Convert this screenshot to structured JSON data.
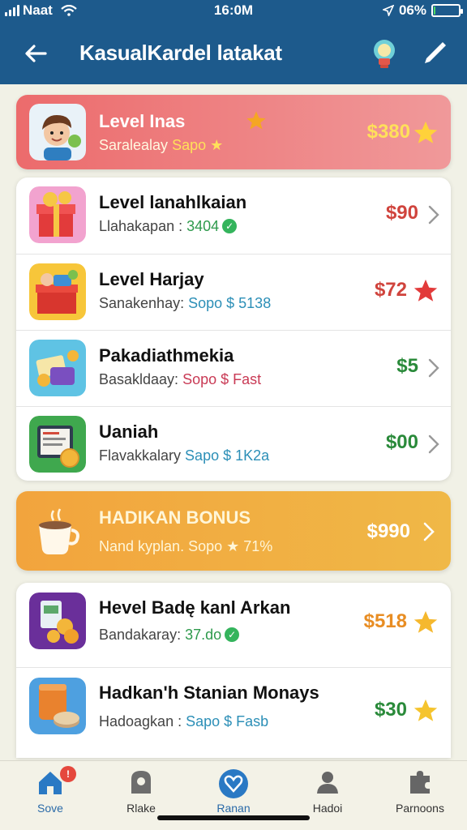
{
  "status_bar": {
    "carrier": "Naat",
    "time": "16:0M",
    "battery": "06%",
    "battery_level": 0.06
  },
  "header": {
    "title": "KasualKardel latakat",
    "back_icon": "arrow-left-icon",
    "bulb_icon": "lightbulb-icon",
    "edit_icon": "pencil-icon"
  },
  "featured": {
    "title": "Level Inas",
    "subtitle": "Saralealay",
    "subtitle_tag": "Sapo",
    "price": "$380",
    "accent": "#ec6b6c"
  },
  "list_top": [
    {
      "title": "Level lanahlkaian",
      "subtitle": "Llahakapan :",
      "detail": "3404",
      "detail_style": "sub-a",
      "price": "$90",
      "price_color": "red",
      "trail": "chevron",
      "thumb": "gift-box",
      "check": true
    },
    {
      "title": "Level Harjay",
      "subtitle": "Sanakenhay:",
      "detail": "Sopo $ 5138",
      "detail_style": "sub-b",
      "price": "$72",
      "price_color": "red",
      "trail": "star",
      "thumb": "gift-box-avatar",
      "check": false
    },
    {
      "title": "Pakadiathmekia",
      "subtitle": "Basakldaay:",
      "detail": "Sopo $ Fast",
      "detail_style": "sub-c",
      "price": "$5",
      "price_color": "green",
      "trail": "chevron",
      "thumb": "coins-cards",
      "check": false
    },
    {
      "title": "Uaniah",
      "subtitle": "Flavakkalary",
      "detail": "Sapo $ 1K2a",
      "detail_style": "sub-b",
      "price": "$00",
      "price_color": "green",
      "trail": "chevron",
      "thumb": "tablet-coin",
      "check": false
    }
  ],
  "bonus": {
    "title": "HADIKAN BONUS",
    "subtitle": "Nand kyplan. Sopo ★ 71%",
    "price": "$990",
    "accent": "#f2a43d"
  },
  "list_bottom": [
    {
      "title": "Hevel Badę kanl Arkan",
      "subtitle": "Bandakaray:",
      "detail": "37.do",
      "detail_style": "sub-a",
      "price": "$518",
      "price_color": "orange",
      "trail": "star",
      "thumb": "purple-coins",
      "check": true
    },
    {
      "title": "Hadkan'h Stanian Monays",
      "subtitle": "Hadoagkan :",
      "detail": "Sapo $ Fasb",
      "detail_style": "sub-b",
      "price": "$30",
      "price_color": "green",
      "trail": "star",
      "thumb": "jar-cookie",
      "check": false
    }
  ],
  "bottom_nav": [
    {
      "label": "Sove",
      "icon": "home-icon",
      "active": true,
      "badge": "!"
    },
    {
      "label": "Rlake",
      "icon": "shield-icon",
      "active": false
    },
    {
      "label": "Ranan",
      "icon": "heart-circle-icon",
      "active": true
    },
    {
      "label": "Hadoi",
      "icon": "user-icon",
      "active": false
    },
    {
      "label": "Parnoons",
      "icon": "puzzle-icon",
      "active": false
    }
  ]
}
